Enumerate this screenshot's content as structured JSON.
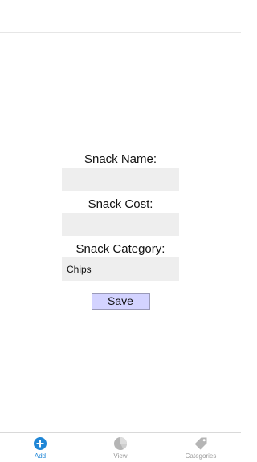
{
  "form": {
    "name_label": "Snack Name:",
    "name_value": "",
    "cost_label": "Snack Cost:",
    "cost_value": "",
    "category_label": "Snack Category:",
    "category_value": "Chips",
    "save_label": "Save"
  },
  "tabs": [
    {
      "label": "Add",
      "icon": "add-circle-icon",
      "active": true
    },
    {
      "label": "View",
      "icon": "pie-chart-icon",
      "active": false
    },
    {
      "label": "Categories",
      "icon": "tag-icon",
      "active": false
    }
  ],
  "colors": {
    "accent": "#1f86d6",
    "inactive": "#9a9a9a",
    "button_bg": "#d3d3ff",
    "input_bg": "#eeeeee"
  }
}
